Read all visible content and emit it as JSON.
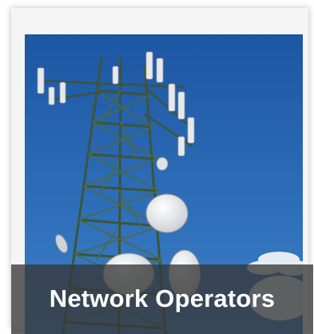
{
  "tile": {
    "title": "Network Operators"
  },
  "photo": {
    "subject": "telecom-tower",
    "colors": {
      "sky_top": "#1f5aa8",
      "sky_bottom": "#3a7cc4",
      "lattice": "#3f5b3a",
      "antenna": "#e6e6e6",
      "dish": "#f0f0f0",
      "cloud": "#eef2f6"
    }
  },
  "caption_band": {
    "background": "#373737"
  }
}
